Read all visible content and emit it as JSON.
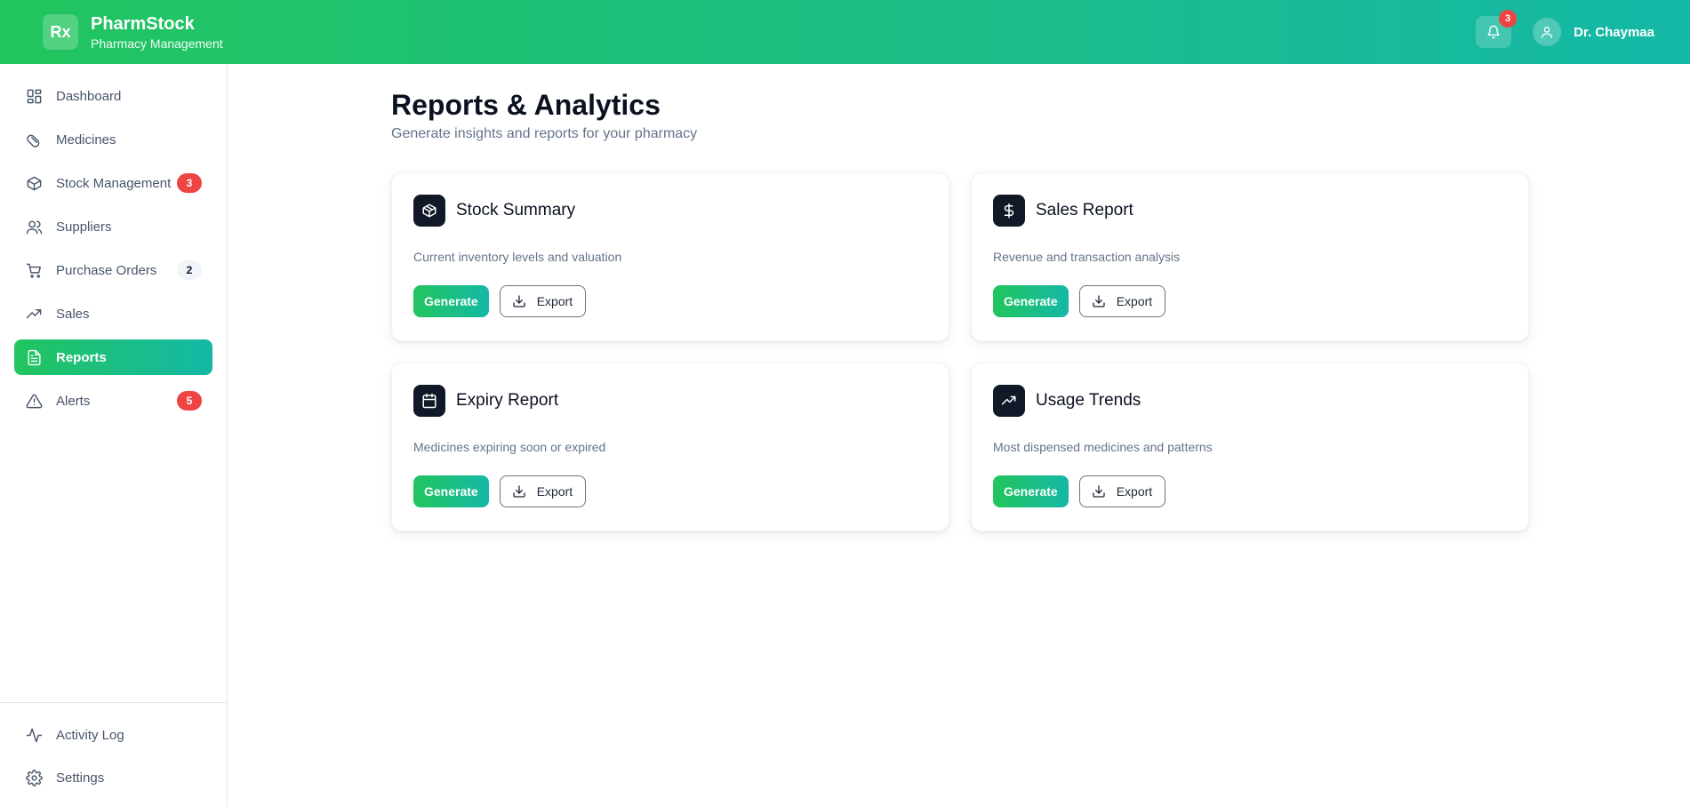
{
  "header": {
    "logo_text": "Rx",
    "app_name": "PharmStock",
    "app_subtitle": "Pharmacy Management",
    "notifications_count": "3",
    "user_name": "Dr. Chaymaa",
    "gradient_start": "#22c55e",
    "gradient_end": "#14b8a6"
  },
  "sidebar": {
    "items": [
      {
        "label": "Dashboard",
        "icon": "layout-grid-icon",
        "active": false,
        "badge": null
      },
      {
        "label": "Medicines",
        "icon": "pill-icon",
        "active": false,
        "badge": null
      },
      {
        "label": "Stock Management",
        "icon": "package-icon",
        "active": false,
        "badge": "3",
        "badge_style": "red"
      },
      {
        "label": "Suppliers",
        "icon": "users-icon",
        "active": false,
        "badge": null
      },
      {
        "label": "Purchase Orders",
        "icon": "shopping-cart-icon",
        "active": false,
        "badge": "2",
        "badge_style": "gray"
      },
      {
        "label": "Sales",
        "icon": "trending-up-icon",
        "active": false,
        "badge": null
      },
      {
        "label": "Reports",
        "icon": "file-text-icon",
        "active": true,
        "badge": null
      },
      {
        "label": "Alerts",
        "icon": "alert-triangle-icon",
        "active": false,
        "badge": "5",
        "badge_style": "red"
      }
    ],
    "bottom_items": [
      {
        "label": "Activity Log",
        "icon": "activity-icon"
      },
      {
        "label": "Settings",
        "icon": "gear-icon"
      }
    ]
  },
  "main": {
    "title": "Reports & Analytics",
    "subtitle": "Generate insights and reports for your pharmacy",
    "cards": [
      {
        "title": "Stock Summary",
        "description": "Current inventory levels and valuation",
        "icon": "package-icon",
        "generate_label": "Generate",
        "export_label": "Export"
      },
      {
        "title": "Sales Report",
        "description": "Revenue and transaction analysis",
        "icon": "dollar-sign-icon",
        "generate_label": "Generate",
        "export_label": "Export"
      },
      {
        "title": "Expiry Report",
        "description": "Medicines expiring soon or expired",
        "icon": "calendar-icon",
        "generate_label": "Generate",
        "export_label": "Export"
      },
      {
        "title": "Usage Trends",
        "description": "Most dispensed medicines and patterns",
        "icon": "trending-up-icon",
        "generate_label": "Generate",
        "export_label": "Export"
      }
    ]
  }
}
